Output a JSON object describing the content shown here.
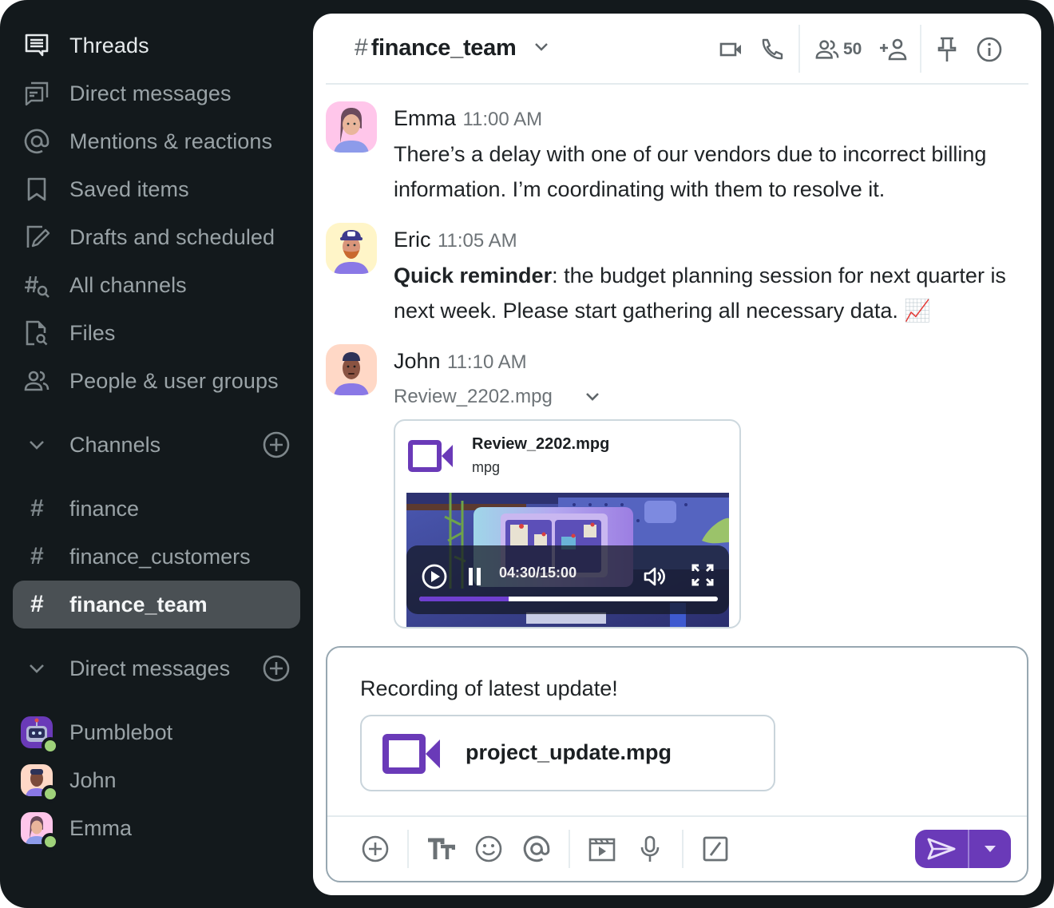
{
  "sidebar": {
    "nav": [
      {
        "label": "Threads",
        "icon": "threads-icon"
      },
      {
        "label": "Direct messages",
        "icon": "direct-messages-icon"
      },
      {
        "label": "Mentions & reactions",
        "icon": "at-icon"
      },
      {
        "label": "Saved items",
        "icon": "bookmark-icon"
      },
      {
        "label": "Drafts and scheduled",
        "icon": "draft-edit-icon"
      },
      {
        "label": "All channels",
        "icon": "channel-search-icon"
      },
      {
        "label": "Files",
        "icon": "file-search-icon"
      },
      {
        "label": "People & user groups",
        "icon": "people-icon"
      }
    ],
    "channels_header": "Channels",
    "channels": [
      {
        "name": "finance",
        "active": false
      },
      {
        "name": "finance_customers",
        "active": false
      },
      {
        "name": "finance_team",
        "active": true
      }
    ],
    "dm_header": "Direct messages",
    "dms": [
      {
        "name": "Pumblebot",
        "status": "online"
      },
      {
        "name": "John",
        "status": "online"
      },
      {
        "name": "Emma",
        "status": "online"
      }
    ]
  },
  "header": {
    "hash": "#",
    "channel_name": "finance_team",
    "member_count": "50"
  },
  "messages": [
    {
      "author": "Emma",
      "time": "11:00 AM",
      "text": "There’s a delay with one of our vendors due to incorrect billing information. I’m coordinating with them to resolve it."
    },
    {
      "author": "Eric",
      "time": "11:05 AM",
      "bold_prefix": "Quick reminder",
      "text": ": the budget planning session for next quarter is next week. Please start gathering all necessary data. 📈"
    },
    {
      "author": "John",
      "time": "11:10 AM",
      "attachment_toggle": "Review_2202.mpg",
      "attachment": {
        "name": "Review_2202.mpg",
        "type": "mpg",
        "video_time": "04:30/15:00",
        "progress": 0.3
      }
    }
  ],
  "composer": {
    "text": "Recording of latest update!",
    "attachment_name": "project_update.mpg"
  },
  "colors": {
    "accent": "#6a3ab8",
    "sidebar_bg": "#13191c",
    "online": "#9fd27a"
  }
}
